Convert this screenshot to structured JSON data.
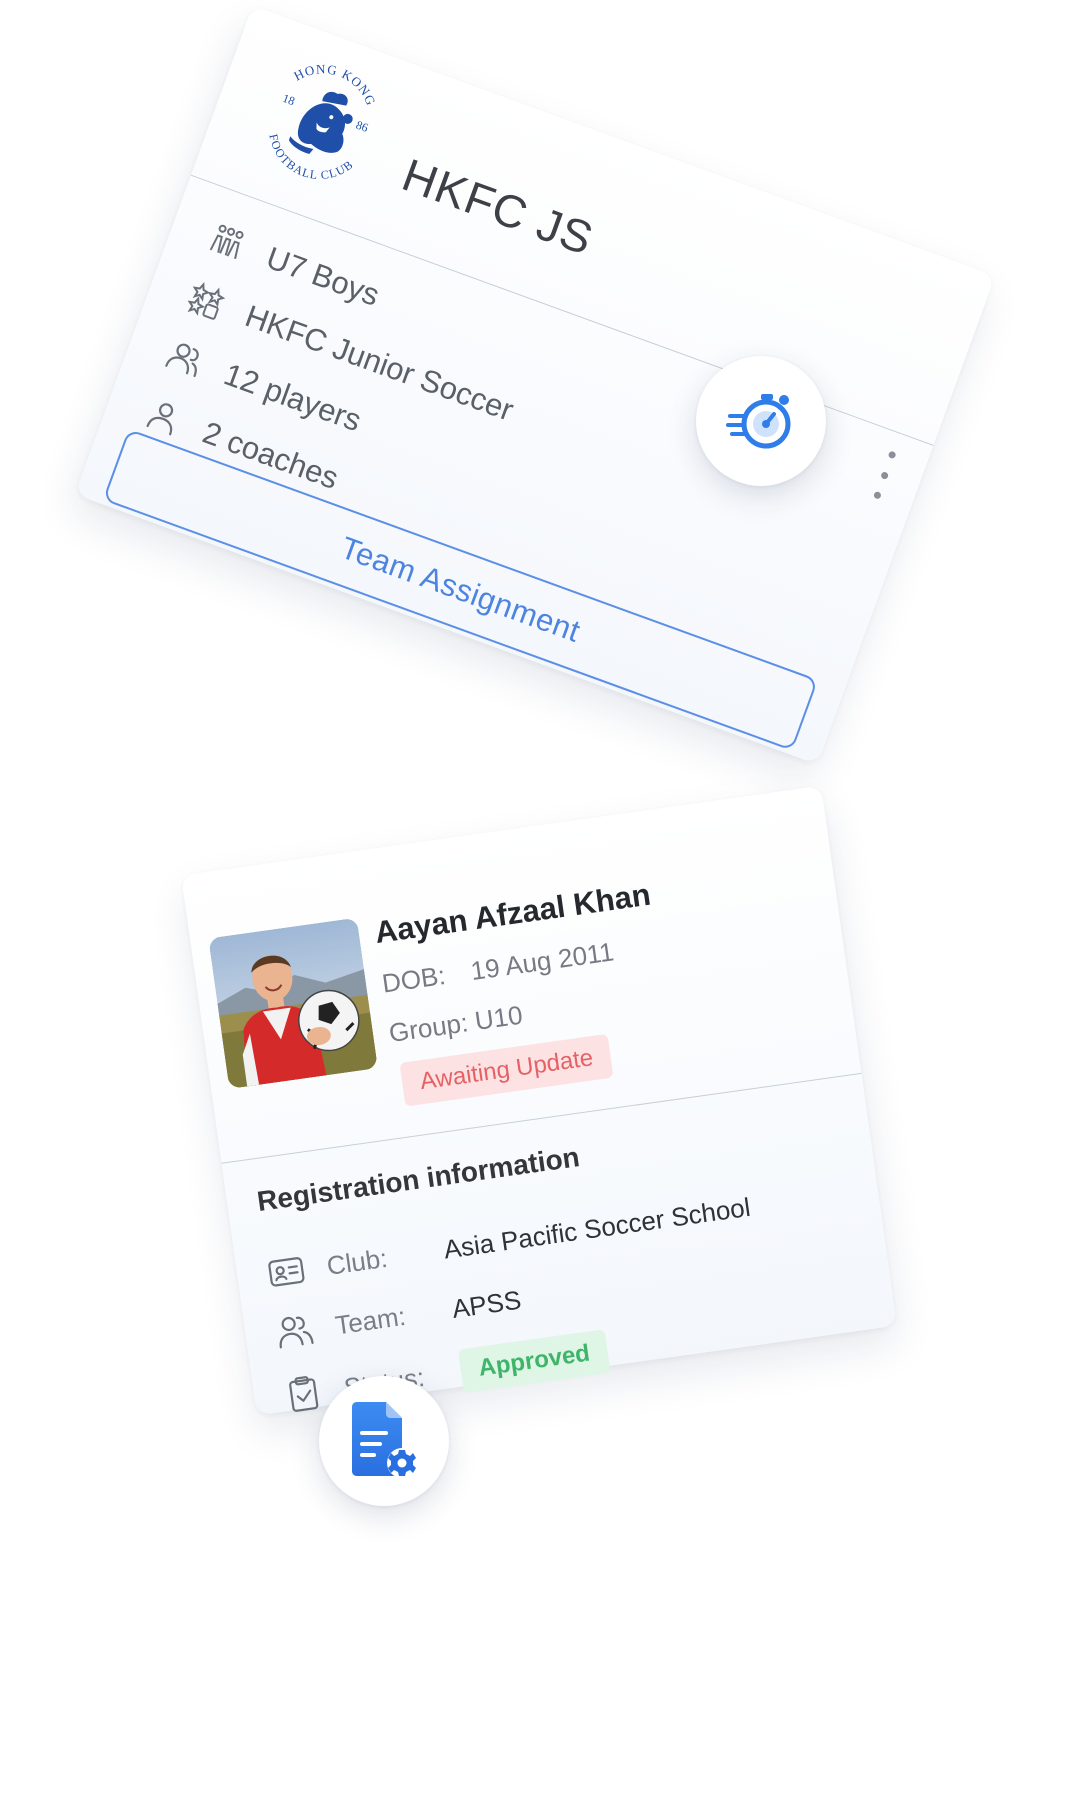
{
  "team_card": {
    "team_name": "HKFC JS",
    "logo": {
      "top_text": "HONG KONG",
      "bottom_text": "FOOTBALL CLUB",
      "year_left_top": "18",
      "year_right_top": "86",
      "icon": "lion-crest-logo"
    },
    "rows": [
      {
        "icon": "children-icon",
        "label": "U7 Boys"
      },
      {
        "icon": "grid-stars-icon",
        "label": "HKFC Junior Soccer"
      },
      {
        "icon": "users-icon",
        "label": "12 players"
      },
      {
        "icon": "user-icon",
        "label": "2 coaches"
      }
    ],
    "action_label": "Team Assignment",
    "menu_icon": "more-vertical-icon"
  },
  "timer_badge": {
    "icon": "stopwatch-speed-icon",
    "color": "#2f7de8"
  },
  "player_card": {
    "name": "Aayan Afzaal Khan",
    "dob_label": "DOB:",
    "dob_value": "19 Aug 2011",
    "group_label": "Group: U10",
    "status_badge": "Awaiting Update",
    "registration": {
      "title": "Registration information",
      "club_label": "Club:",
      "club_value": "Asia Pacific Soccer School",
      "team_label": "Team:",
      "team_value": "APSS",
      "status_label": "Status:",
      "status_value": "Approved"
    }
  },
  "doc_badge": {
    "icon": "document-settings-icon",
    "color": "#2f7de8"
  },
  "colors": {
    "accent": "#4d84e0",
    "awaiting_bg": "#fde2e3",
    "awaiting_fg": "#e56166",
    "approved_bg": "#dff5e6",
    "approved_fg": "#3fb56a"
  }
}
